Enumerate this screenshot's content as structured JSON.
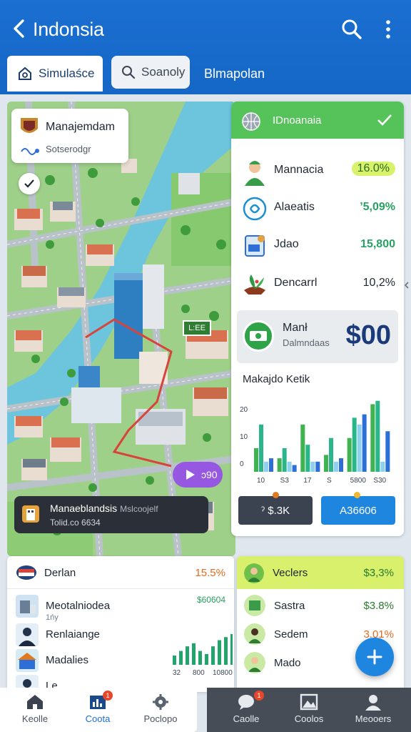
{
  "header": {
    "title": "Indonsia",
    "tabs": [
      {
        "label": "Simulaśce",
        "icon": "home-gear-icon"
      },
      {
        "label": "Soanoly",
        "icon": "search-icon"
      },
      {
        "label": "Blmapolan"
      }
    ]
  },
  "map": {
    "card_title": "Manajemdam",
    "card_subtitle": "Sotserodgr",
    "tag": "L:EE",
    "play_label": "ɔ90",
    "banner_title": "Manaeblandsis",
    "banner_extra": "Mslcoojelf",
    "banner_sub": "Tolid.co 6634"
  },
  "right_panel": {
    "title": "IDnoanaia",
    "rows": [
      {
        "name": "Mannacia",
        "value": "16.0%",
        "color": "#2a6b22",
        "icon": "person-avatar-icon"
      },
      {
        "name": "Alaeatis",
        "value": "ʼ5,09%",
        "color": "#27a263",
        "icon": "link-icon"
      },
      {
        "name": "Jdao",
        "value": "15,800",
        "color": "#27a263",
        "icon": "document-icon"
      },
      {
        "name": "Dencarrl",
        "value": "10,2%",
        "color": "#1f2833",
        "icon": "plant-icon"
      }
    ],
    "money": {
      "title": "Manł",
      "subtitle": "Dalmndaas",
      "amount": "$00"
    },
    "chart_title": "Makajdo Ketik",
    "btn_left": "ˀ $.3K",
    "btn_right": "A36606"
  },
  "chart_data": [
    {
      "type": "bar",
      "title": "Makajdo Ketik",
      "categories": [
        "10",
        "S3",
        "17",
        "S",
        "5800",
        "S30"
      ],
      "y_ticks": [
        "20",
        "10",
        "0"
      ],
      "series": [
        {
          "color": "#3fb34f",
          "values": [
            7,
            4,
            14,
            5,
            10,
            20
          ]
        },
        {
          "color": "#2bb58a",
          "values": [
            14,
            7,
            8,
            10,
            16,
            21
          ]
        },
        {
          "color": "#8fd0ef",
          "values": [
            3,
            3,
            3,
            3,
            14,
            3
          ]
        },
        {
          "color": "#2d6fd6",
          "values": [
            4,
            2,
            3,
            4,
            17,
            12
          ]
        }
      ]
    },
    {
      "type": "bar",
      "categories": [
        "32",
        "800",
        "10800"
      ],
      "series": [
        {
          "color": "#22a56c",
          "values": [
            6,
            9,
            12,
            14,
            9,
            7,
            12,
            16,
            18,
            20,
            24,
            17
          ]
        }
      ]
    }
  ],
  "bottom_left": {
    "title": "Derlan",
    "value": "15.5%",
    "items": [
      {
        "name": "Meotalniodea",
        "sub": "1ńy"
      },
      {
        "name": "Renlaiange",
        "sub": ""
      },
      {
        "name": "Madalies",
        "sub": ""
      },
      {
        "name": "Le",
        "sub": ""
      }
    ],
    "right_value": "$60604"
  },
  "bottom_right": {
    "title": "Veclers",
    "value": "$3,3%",
    "rows": [
      {
        "name": "Sastra",
        "value": "$3.8%",
        "color": "#2a7a30"
      },
      {
        "name": "Sedem",
        "value": "3.01%",
        "color": "#e46b21"
      },
      {
        "name": "Mado",
        "value": "",
        "color": "#1f2833"
      }
    ]
  },
  "nav": [
    {
      "label": "Keolle",
      "icon": "home-icon",
      "active": false
    },
    {
      "label": "Coota",
      "icon": "chart-icon",
      "active": true,
      "badge": "1"
    },
    {
      "label": "Poclopo",
      "icon": "gear-icon",
      "active": false
    },
    {
      "label": "Caolle",
      "icon": "chat-icon",
      "active": false,
      "badge": "1"
    },
    {
      "label": "Coolos",
      "icon": "image-icon",
      "active": false
    },
    {
      "label": "Meooers",
      "icon": "user-icon",
      "active": false
    }
  ]
}
